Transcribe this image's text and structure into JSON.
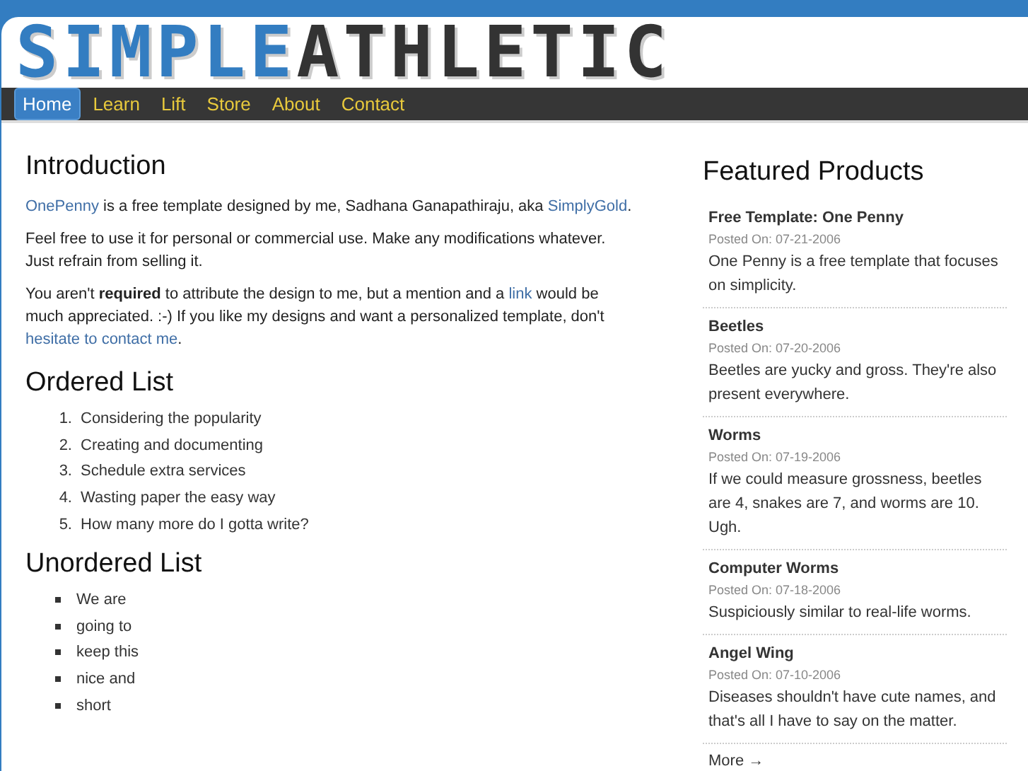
{
  "logo": {
    "first": "SIMPLE",
    "second": "ATHLETIC"
  },
  "nav": [
    {
      "label": "Home",
      "selected": true
    },
    {
      "label": "Learn",
      "selected": false
    },
    {
      "label": "Lift",
      "selected": false
    },
    {
      "label": "Store",
      "selected": false
    },
    {
      "label": "About",
      "selected": false
    },
    {
      "label": "Contact",
      "selected": false
    }
  ],
  "main": {
    "heading": "Introduction",
    "paragraphs": [
      [
        {
          "kind": "link",
          "text": "OnePenny"
        },
        {
          "kind": "text",
          "text": " is a free template designed by me, Sadhana Ganapathiraju, aka "
        },
        {
          "kind": "link",
          "text": "SimplyGold"
        },
        {
          "kind": "text",
          "text": "."
        }
      ],
      [
        {
          "kind": "text",
          "text": "Feel free to use it for personal or commercial use. Make any modifications whatever. Just refrain from selling it."
        }
      ],
      [
        {
          "kind": "text",
          "text": "You aren't "
        },
        {
          "kind": "bold",
          "text": "required"
        },
        {
          "kind": "text",
          "text": " to attribute the design to me, but a mention and a "
        },
        {
          "kind": "link",
          "text": "link"
        },
        {
          "kind": "text",
          "text": " would be much appreciated. :-) If you like my designs and want a personalized template, don't "
        },
        {
          "kind": "link",
          "text": "hesitate to contact me"
        },
        {
          "kind": "text",
          "text": "."
        }
      ]
    ],
    "ordered_heading": "Ordered List",
    "ordered": [
      {
        "number": "1.",
        "text": "Considering the popularity"
      },
      {
        "number": "2.",
        "text": "Creating and documenting"
      },
      {
        "number": "3.",
        "text": "Schedule extra services"
      },
      {
        "number": "4.",
        "text": "Wasting paper the easy way"
      },
      {
        "number": "5.",
        "text": "How many more do I gotta write?"
      }
    ],
    "unordered_heading": "Unordered List",
    "unordered": [
      "We are",
      "going to",
      "keep this",
      "nice and",
      "short"
    ]
  },
  "sidebar": {
    "title": "Featured Products",
    "products": [
      {
        "name": "Free Template: One Penny",
        "date": "Posted On: 07-21-2006",
        "text": "One Penny is a free template that focuses on simplicity."
      },
      {
        "name": "Beetles",
        "date": "Posted On: 07-20-2006",
        "text": "Beetles are yucky and gross. They're also present everywhere."
      },
      {
        "name": "Worms",
        "date": "Posted On: 07-19-2006",
        "text": "If we could measure grossness, beetles are 4, snakes are 7, and worms are 10. Ugh."
      },
      {
        "name": "Computer Worms",
        "date": "Posted On: 07-18-2006",
        "text": "Suspiciously similar to real-life worms."
      },
      {
        "name": "Angel Wing",
        "date": "Posted On: 07-10-2006",
        "text": "Diseases shouldn't have cute names, and that's all I have to say on the matter."
      }
    ],
    "more": "More →"
  }
}
